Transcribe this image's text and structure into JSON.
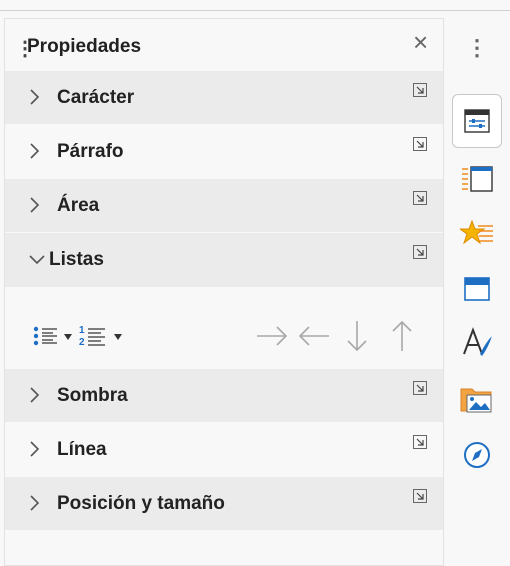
{
  "panel": {
    "title": "Propiedades"
  },
  "sections": [
    {
      "label": "Carácter"
    },
    {
      "label": "Párrafo"
    },
    {
      "label": "Área"
    },
    {
      "label": "Listas"
    },
    {
      "label": "Sombra"
    },
    {
      "label": "Línea"
    },
    {
      "label": "Posición y tamaño"
    }
  ],
  "colors": {
    "accent": "#1e6fc4",
    "orange": "#f08a1c",
    "gray_icon": "#a0a0a0"
  },
  "icons": {
    "deck": [
      "properties-icon",
      "styles-icon",
      "gallery-icon",
      "navigator-frame-icon",
      "functions-icon",
      "image-gallery-icon",
      "navigator-icon"
    ],
    "list_tools": [
      "unordered-list-icon",
      "ordered-list-icon",
      "move-right-icon",
      "move-left-icon",
      "move-down-icon",
      "move-up-icon"
    ]
  }
}
